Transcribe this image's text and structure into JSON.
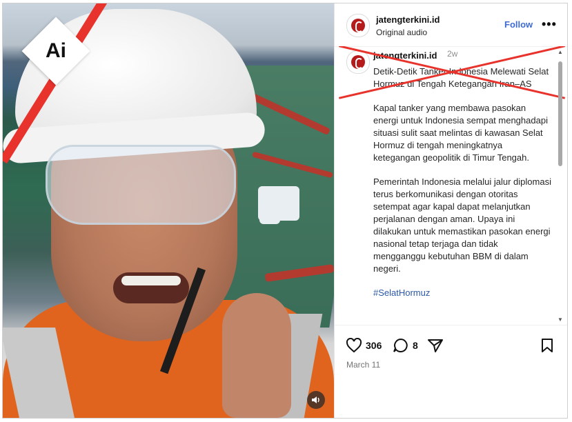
{
  "post": {
    "username": "jatengterkini.id",
    "audio": "Original audio",
    "follow_label": "Follow",
    "more_label": "•••",
    "time_ago": "2w",
    "caption_title": "Detik-Detik Tanker Indonesia Melewati Selat Hormuz di Tengah Ketegangan Iran–AS",
    "caption_paragraphs": [
      "Kapal tanker yang membawa pasokan energi untuk Indonesia sempat menghadapi situasi sulit saat melintas di kawasan Selat Hormuz di tengah meningkatnya ketegangan geopolitik di Timur Tengah.",
      "Pemerintah Indonesia melalui jalur diplomasi terus berkomunikasi dengan otoritas setempat agar kapal dapat melanjutkan perjalanan dengan aman. Upaya ini dilakukan untuk memastikan pasokan energi nasional tetap terjaga dan tidak mengganggu kebutuhan BBM di dalam negeri."
    ],
    "hashtag": "#SelatHormuz",
    "likes": "306",
    "comments": "8",
    "date": "March 11"
  },
  "overlay": {
    "badge_text": "Ai",
    "accent_red": "#e8332c"
  },
  "icons": {
    "like": "heart-icon",
    "comment": "comment-icon",
    "share": "send-icon",
    "save": "bookmark-icon",
    "audio": "speaker-icon"
  }
}
